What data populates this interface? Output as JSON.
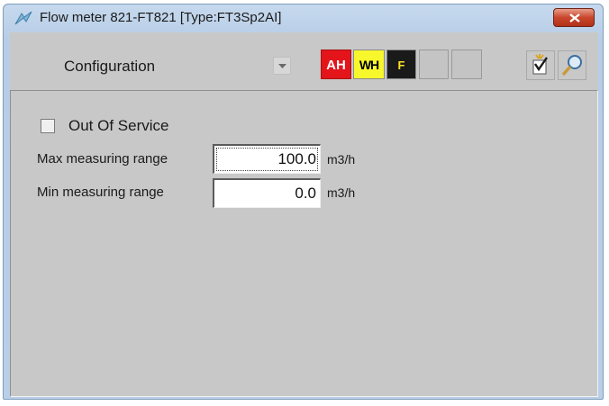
{
  "window": {
    "title": "Flow meter 821-FT821  [Type:FT3Sp2AI]",
    "icon": "flow-meter-icon",
    "close_icon": "close-icon"
  },
  "toolbar": {
    "view_selected": "Configuration",
    "alarm_boxes": [
      {
        "label": "AH",
        "color": "#e4141b",
        "text_color": "#ffffff"
      },
      {
        "label": "WH",
        "color": "#f7f72c",
        "text_color": "#000000"
      },
      {
        "label": "F",
        "color": "#1a1a1a",
        "text_color": "#ffe02a"
      },
      {
        "label": "",
        "color": "#c4c4c4"
      },
      {
        "label": "",
        "color": "#c4c4c4"
      }
    ],
    "buttons": [
      "checklist-icon",
      "magnifier-icon"
    ]
  },
  "config": {
    "out_of_service_label": "Out Of Service",
    "out_of_service_checked": false,
    "max_label": "Max measuring range",
    "max_value": "100.0",
    "max_unit": "m3/h",
    "min_label": "Min measuring range",
    "min_value": "0.0",
    "min_unit": "m3/h"
  }
}
